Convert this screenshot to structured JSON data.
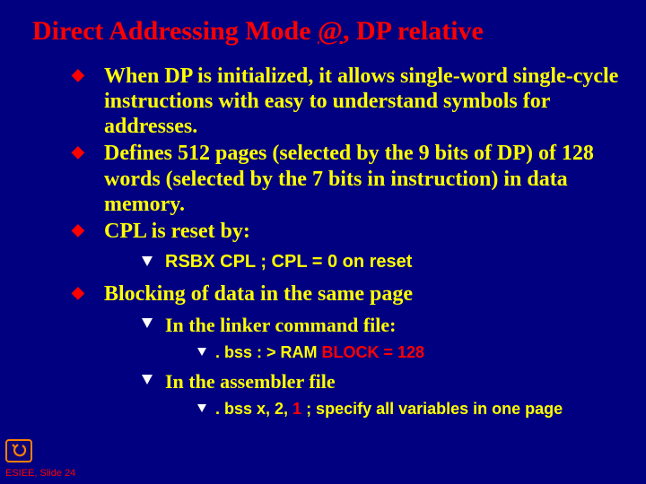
{
  "title_prefix": "Direct Addressing Mode ",
  "title_at": "@",
  "title_suffix": ", DP relative",
  "b1": "When DP is initialized, it allows single-word single-cycle instructions with easy to understand symbols for addresses.",
  "b2": "Defines 512 pages (selected by the 9 bits of DP) of 128 words (selected by the 7 bits in instruction) in data memory.",
  "b3": "CPL is reset by:",
  "b3_s1": "RSBX CPL  ; CPL = 0 on reset",
  "b4": "Blocking of data in the same page",
  "b4_s1": "In the linker command file:",
  "b4_s1_c1_a": ". bss : > RAM ",
  "b4_s1_c1_b": "BLOCK = 128",
  "b4_s2": "In the assembler file",
  "b4_s2_c1_a": ". bss   x, 2, ",
  "b4_s2_c1_b": "1",
  "b4_s2_c1_c": "   ; specify all variables in one page",
  "footer": "ESIEE, Slide 24"
}
